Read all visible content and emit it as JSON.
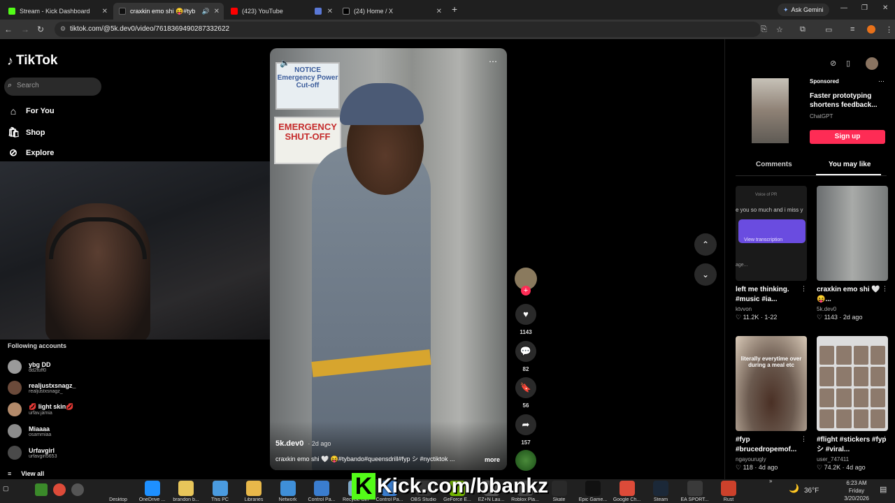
{
  "browser": {
    "tabs": [
      {
        "title": "Stream - Kick Dashboard",
        "color": "#53fc18"
      },
      {
        "title": "craxkin emo shi 😝#tyb",
        "color": "#111111"
      },
      {
        "title": "(423) YouTube",
        "color": "#ff0000"
      },
      {
        "title": "",
        "color": "#5a78d6"
      },
      {
        "title": "(24) Home / X",
        "color": "#000000"
      }
    ],
    "ask_gemini": "Ask Gemini",
    "url": "tiktok.com/@5k.dev0/video/7618369490287332622"
  },
  "sidebar": {
    "logo": "TikTok",
    "search_placeholder": "Search",
    "nav": [
      {
        "label": "For You",
        "icon": "home-icon"
      },
      {
        "label": "Shop",
        "icon": "shop-icon"
      },
      {
        "label": "Explore",
        "icon": "compass-icon"
      }
    ],
    "following_title": "Following accounts",
    "accounts": [
      {
        "name": "ybg DD",
        "handle": "dd2tuff0"
      },
      {
        "name": "realjustxsnagz_",
        "handle": "realjustxsnagz_"
      },
      {
        "name": "💋 light skin💋",
        "handle": "urfav.jamia"
      },
      {
        "name": "Miaaaa",
        "handle": "osammiaa"
      },
      {
        "name": "Urfavgirl",
        "handle": "urfavgirl5653"
      }
    ],
    "view_all": "View all"
  },
  "video": {
    "notice_text": "NOTICE Emergency Power Cut-off",
    "sign_text": "EMERGENCY SHUT-OFF",
    "author": "5k.dev0",
    "age": "· 2d ago",
    "caption": "craxkin emo shi 🤍 😝#tybando#queensdrill#fyp シ #nyctiktok ...",
    "more": "more",
    "likes": "1143",
    "comments": "82",
    "saves": "56",
    "shares": "157"
  },
  "right_panel": {
    "ad": {
      "sponsored": "Sponsored",
      "title": "Faster prototyping shortens feedback...",
      "brand": "ChatGPT",
      "cta": "Sign up"
    },
    "tabs": [
      "Comments",
      "You may like"
    ],
    "cards": [
      {
        "caption": "left me thinking. #music #ia...",
        "user": "ktvvon",
        "meta": "♡ 11.2K · 1-22",
        "thumb_text": "e you so much and i miss y",
        "thumb_bottom": "age...",
        "view_transcription": "View transcription",
        "header_text": "Voice of PR"
      },
      {
        "caption": "craxkin emo shi 🤍😝...",
        "user": "5k.dev0",
        "meta": "♡ 1143 · 2d ago"
      },
      {
        "caption": "#fyp #brucedropemof...",
        "user": "ngayourugly",
        "meta": "♡ 118 · 4d ago",
        "thumb_text": "literally everytime over during a meal etc"
      },
      {
        "caption": "#flight #stickers #fyp シ #viral...",
        "user": "user_747411",
        "meta": "♡ 74.2K · 4d ago"
      }
    ]
  },
  "overlay": {
    "kick_letter": "K",
    "kick_url": "Kick.com/bbankz"
  },
  "taskbar": {
    "items": [
      {
        "label": "Desktop",
        "color": "#202020"
      },
      {
        "label": "OneDrive ...",
        "color": "#1e90ff"
      },
      {
        "label": "brandon b...",
        "color": "#e8c65a"
      },
      {
        "label": "This PC",
        "color": "#4a9be0"
      },
      {
        "label": "Libraries",
        "color": "#e8b84a"
      },
      {
        "label": "Network",
        "color": "#3f8fd8"
      },
      {
        "label": "Control Pa...",
        "color": "#3a7dcf"
      },
      {
        "label": "Recycle Bin",
        "color": "#7fa8c8"
      },
      {
        "label": "Control Pa...",
        "color": "#3a7dcf"
      },
      {
        "label": "OBS Studio",
        "color": "#333333"
      },
      {
        "label": "GeForce E...",
        "color": "#76b900"
      },
      {
        "label": "EZ+N Lau...",
        "color": "#555555"
      },
      {
        "label": "Roblox Pla...",
        "color": "#444444"
      },
      {
        "label": "Skate",
        "color": "#2a2a2a"
      },
      {
        "label": "Epic Game...",
        "color": "#111111"
      },
      {
        "label": "Google Ch...",
        "color": "#dd4b39"
      },
      {
        "label": "Steam",
        "color": "#1b2838"
      },
      {
        "label": "EA SPORT...",
        "color": "#3a3a3a"
      },
      {
        "label": "Rust",
        "color": "#cd412b"
      }
    ],
    "weather": "36°F",
    "time": "6:23 AM",
    "day": "Friday",
    "date": "3/20/2026"
  }
}
